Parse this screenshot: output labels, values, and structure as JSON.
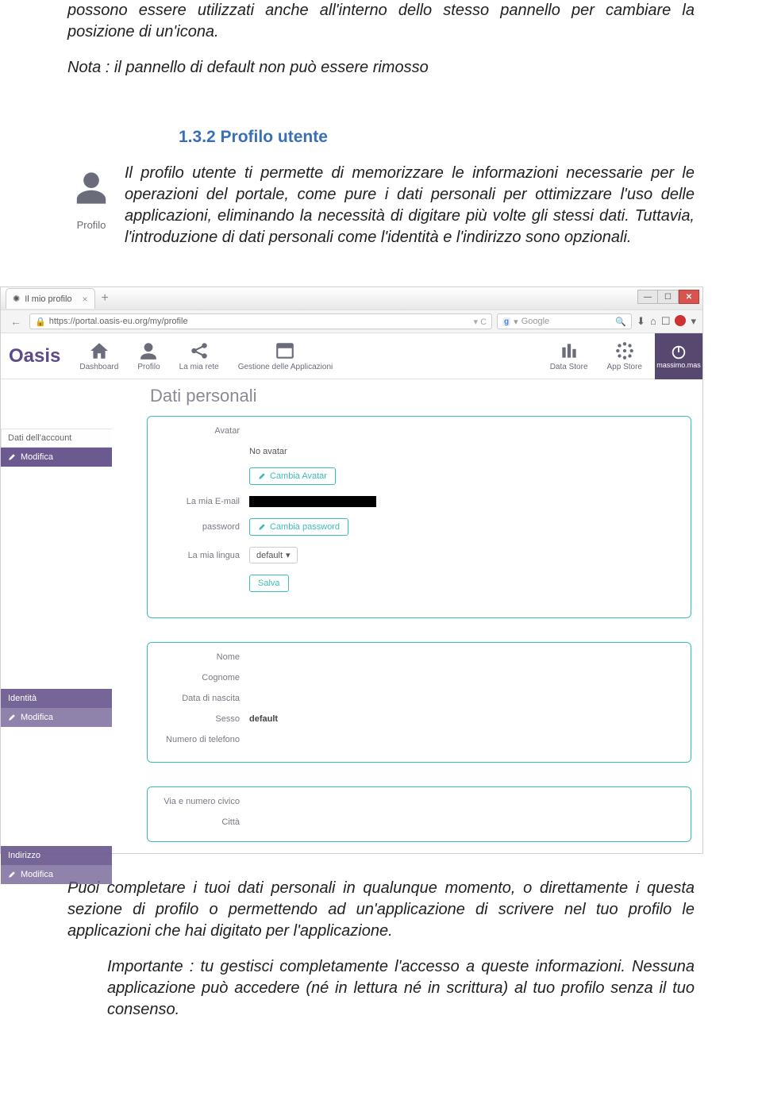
{
  "doc": {
    "intro1": "possono essere utilizzati anche all'interno dello stesso pannello per cambiare la posizione di un'icona.",
    "note": "Nota : il pannello di default non può essere rimosso",
    "heading": "1.3.2  Profilo utente",
    "profile_icon_caption": "Profilo",
    "body": "Il profilo utente ti permette di memorizzare le informazioni necessarie per le operazioni del portale, come pure i dati personali per ottimizzare l'uso delle applicazioni, eliminando la necessità di digitare più volte gli stessi dati. Tuttavia, l'introduzione di dati personali come l'identità e l'indirizzo sono opzionali.",
    "after1": "Puoi completare i tuoi dati personali in qualunque momento, o direttamente i questa sezione di profilo o permettendo ad un'applicazione di scrivere nel tuo profilo le applicazioni che hai digitato per l'applicazione.",
    "after2": "Importante : tu gestisci completamente l'accesso a queste informazioni. Nessuna applicazione può accedere (né in lettura né in scrittura) al tuo profilo senza il tuo consenso."
  },
  "browser": {
    "tab_title": "Il mio profilo",
    "url": "https://portal.oasis-eu.org/my/profile",
    "search_placeholder": "Google",
    "reload_label": "C"
  },
  "oasis": {
    "logo": "Oasis",
    "nav": {
      "dashboard": "Dashboard",
      "profilo": "Profilo",
      "rete": "La mia rete",
      "gestione": "Gestione delle Applicazioni",
      "datastore": "Data Store",
      "appstore": "App Store",
      "user": "massimo.mas"
    },
    "section_title": "Dati personali",
    "sidebar": {
      "account": "Dati dell'account",
      "modifica": "Modifica",
      "identita": "Identità",
      "indirizzo": "Indirizzo"
    },
    "form": {
      "avatar_label": "Avatar",
      "no_avatar": "No avatar",
      "cambia_avatar": "Cambia Avatar",
      "email_label": "La mia E-mail",
      "password_label": "password",
      "cambia_password": "Cambia password",
      "lingua_label": "La mia lingua",
      "lingua_value": "default",
      "salva": "Salva",
      "nome": "Nome",
      "cognome": "Cognome",
      "nascita": "Data di nascita",
      "sesso": "Sesso",
      "sesso_value": "default",
      "telefono": "Numero di telefono",
      "via": "Via e numero civico",
      "citta": "Città"
    }
  }
}
